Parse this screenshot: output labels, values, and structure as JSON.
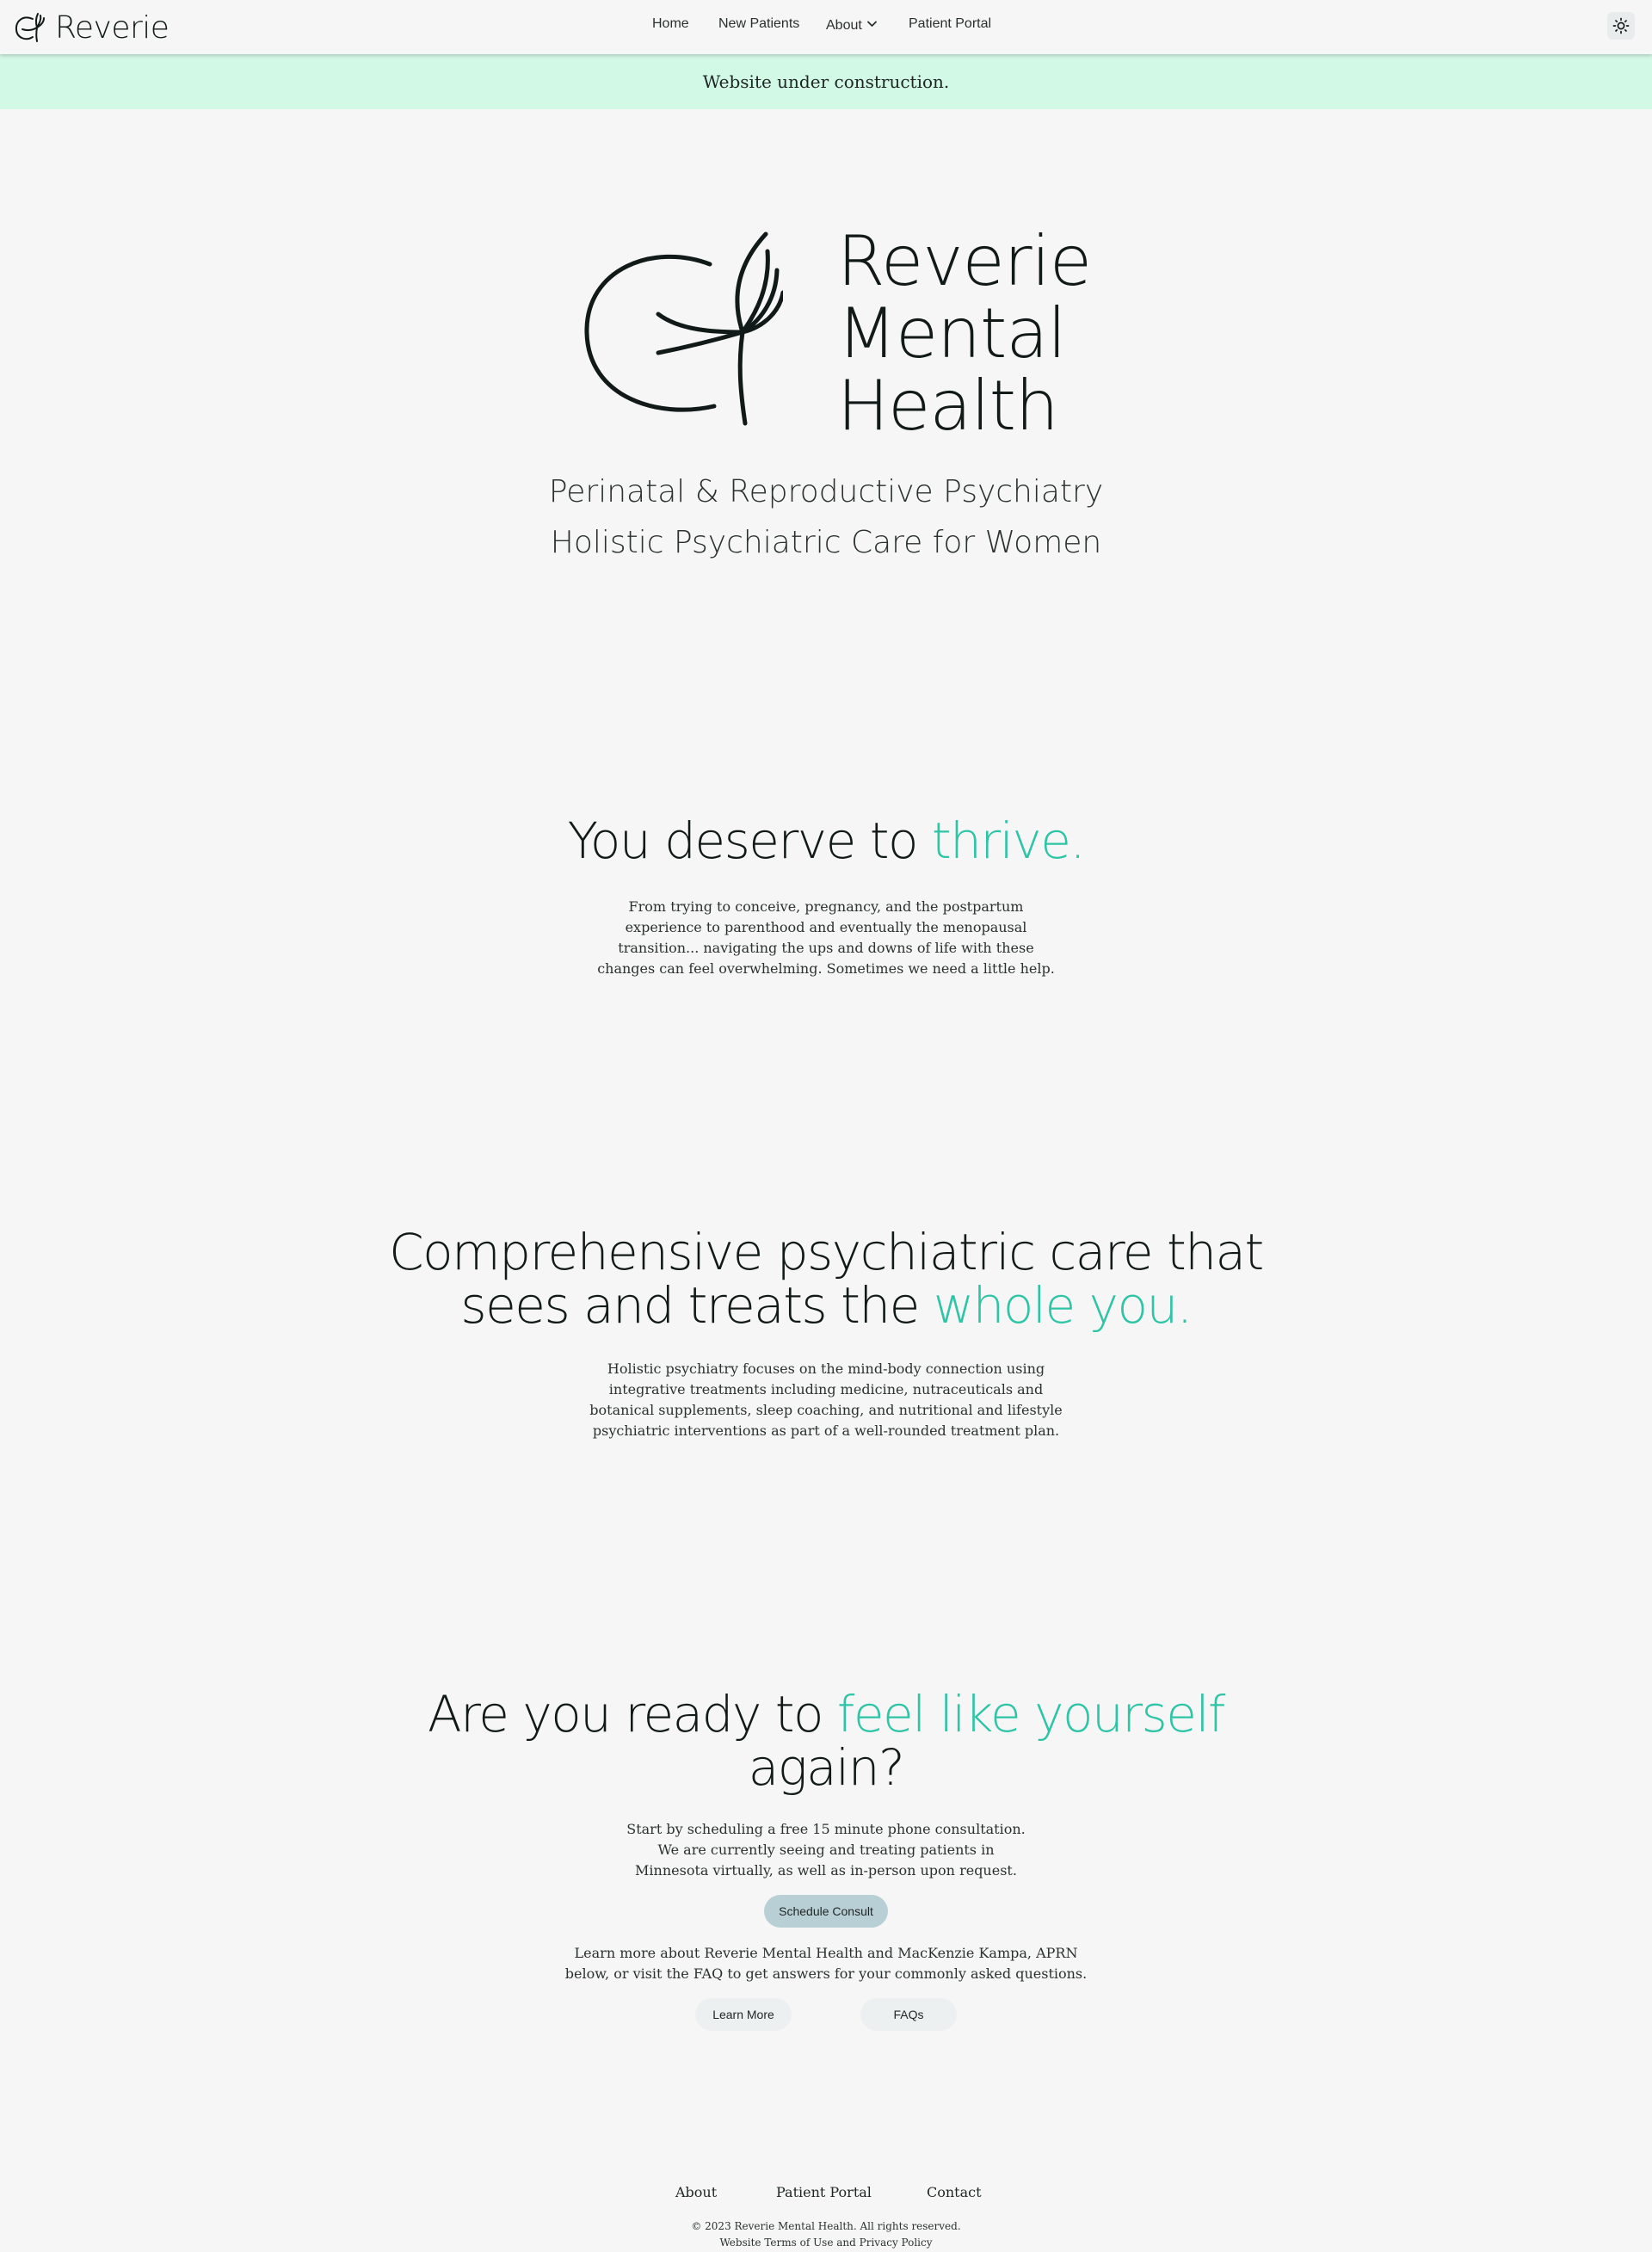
{
  "header": {
    "brand": "Reverie",
    "nav": {
      "home": "Home",
      "new_patients": "New Patients",
      "about": "About",
      "patient_portal": "Patient Portal"
    },
    "theme_toggle_icon": "sun-icon"
  },
  "banner": {
    "text": "Website under construction."
  },
  "hero": {
    "name_line1": "Reverie",
    "name_line2": "Mental",
    "name_line3": "Health",
    "tagline1": "Perinatal & Reproductive Psychiatry",
    "tagline2": "Holistic Psychiatric Care for Women"
  },
  "thrive": {
    "head_plain": "You deserve to ",
    "head_accent": "thrive.",
    "body": [
      "From trying to conceive, pregnancy, and the postpartum",
      "experience to parenthood and eventually the menopausal",
      "transition... navigating the ups and downs of life with these",
      "changes can feel overwhelming. Sometimes we need a little help."
    ]
  },
  "whole": {
    "head_line1": "Comprehensive psychiatric care that",
    "head_line2_plain": "sees and treats the ",
    "head_line2_accent": "whole you.",
    "body": [
      "Holistic psychiatry focuses on the mind-body connection using",
      "integrative treatments including medicine, nutraceuticals and",
      "botanical supplements, sleep coaching, and nutritional and lifestyle",
      "psychiatric interventions as part of a well-rounded treatment plan."
    ]
  },
  "ready": {
    "head_line1_plain": "Are you ready to ",
    "head_line1_accent": "feel like yourself",
    "head_line2": "again?",
    "body": [
      "Start by scheduling a free 15 minute phone consultation.",
      "We are currently seeing and treating patients in",
      "Minnesota virtually, as well as in-person upon request."
    ],
    "schedule_button": "Schedule Consult",
    "more_text": [
      "Learn more about Reverie Mental Health and MacKenzie Kampa, APRN",
      "below, or visit the FAQ to get answers for your commonly asked questions."
    ],
    "learn_more_button": "Learn More",
    "faqs_button": "FAQs"
  },
  "footer": {
    "about": "About",
    "patient_portal": "Patient Portal",
    "contact": "Contact",
    "copyright": "© 2023 Reverie Mental Health. All rights reserved.",
    "legal": "Website Terms of Use and Privacy Policy"
  },
  "colors": {
    "background": "#f6f6f6",
    "accent": "#2ec4a6",
    "banner": "#d2f8e6",
    "text": "#1e2624",
    "primary_button": "#b9cfd6"
  }
}
